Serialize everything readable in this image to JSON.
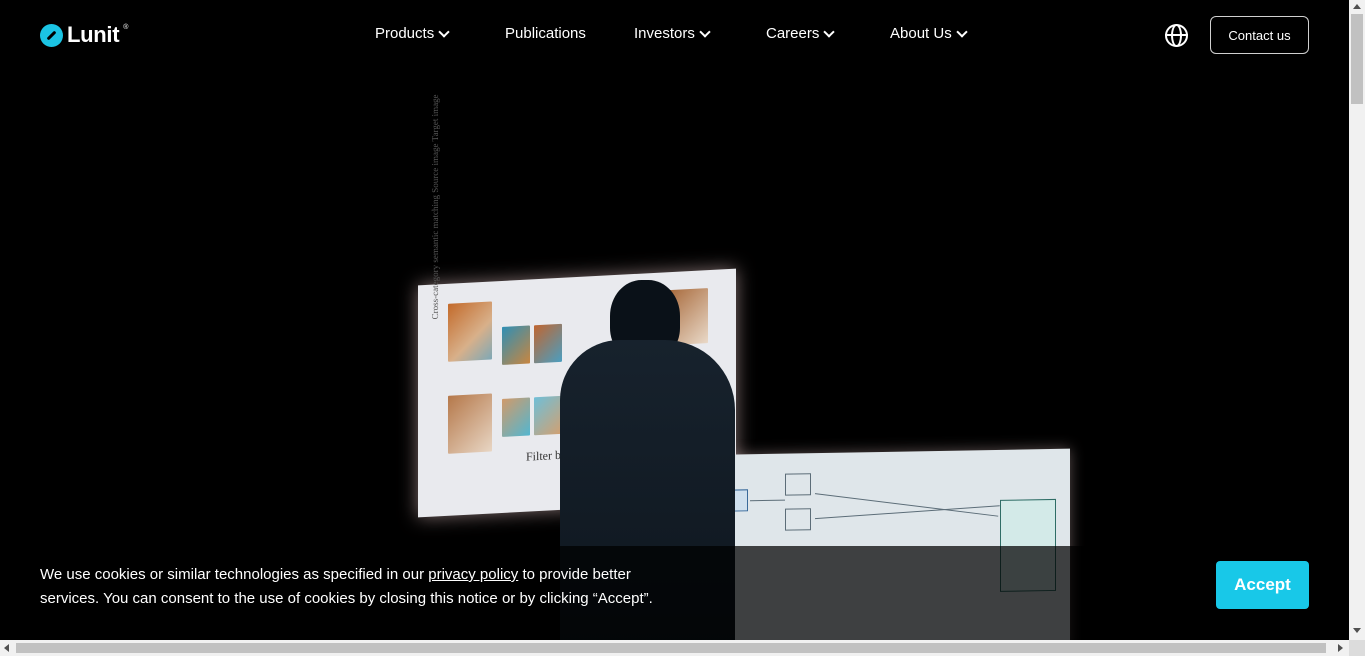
{
  "brand": {
    "name": "Lunit",
    "registered_mark": "®",
    "color": "#1bc4e4"
  },
  "nav": {
    "items": [
      {
        "label": "Products",
        "has_dropdown": true
      },
      {
        "label": "Publications",
        "has_dropdown": false
      },
      {
        "label": "Investors",
        "has_dropdown": true
      },
      {
        "label": "Careers",
        "has_dropdown": true
      },
      {
        "label": "About Us",
        "has_dropdown": true
      }
    ],
    "language_icon": "globe-icon",
    "contact_label": "Contact us"
  },
  "hero": {
    "screen_text": {
      "vertical_label": "Cross-category semantic matching  Source image  Target image",
      "filter_label": "Filter bea"
    }
  },
  "cookie_banner": {
    "text_before_link": "We use cookies or similar technologies as specified in our ",
    "link_text": "privacy policy",
    "text_after_link": " to provide better services. You can consent to the use of cookies by closing this notice or by clicking “Accept”.",
    "accept_label": "Accept",
    "accept_color": "#18c8e8"
  }
}
